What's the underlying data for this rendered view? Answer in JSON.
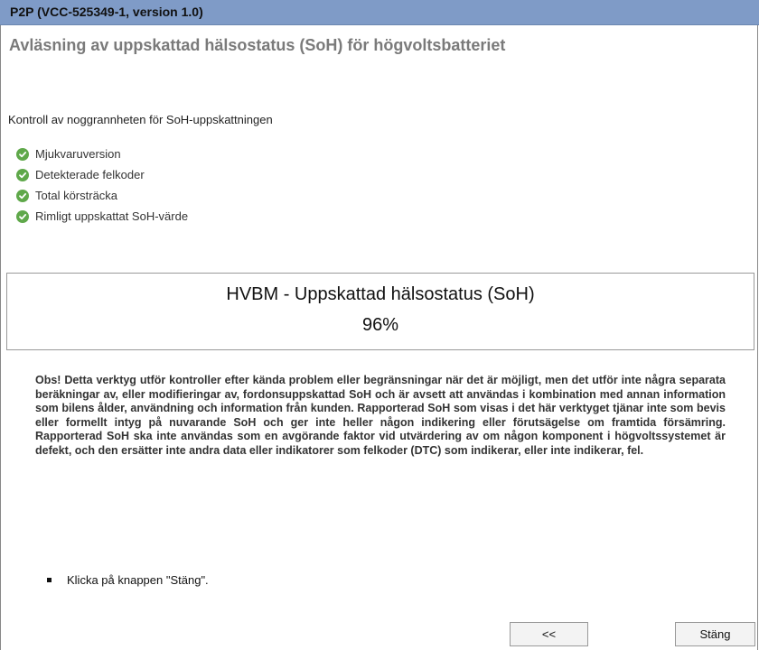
{
  "window": {
    "title": "P2P   (VCC-525349-1, version 1.0)"
  },
  "page": {
    "heading": "Avläsning av uppskattad hälsostatus (SoH) för högvoltsbatteriet",
    "subheading": "Kontroll av noggrannheten för SoH-uppskattningen",
    "checks": [
      {
        "label": "Mjukvaruversion",
        "icon": "check-circle-icon"
      },
      {
        "label": "Detekterade felkoder",
        "icon": "check-circle-icon"
      },
      {
        "label": "Total körsträcka",
        "icon": "check-circle-icon"
      },
      {
        "label": "Rimligt uppskattat SoH-värde",
        "icon": "check-circle-icon"
      }
    ],
    "result": {
      "title": "HVBM - Uppskattad hälsostatus (SoH)",
      "value": "96%"
    },
    "notice": "Obs!  Detta verktyg utför kontroller efter kända problem eller begränsningar när det är möjligt, men det utför inte några separata beräkningar av, eller modifieringar av, fordonsuppskattad SoH och är avsett att användas i kombination med annan information som bilens ålder, användning och information från kunden. Rapporterad SoH som visas i det här verktyget tjänar inte som bevis eller formellt intyg på nuvarande SoH och ger inte heller någon indikering eller förutsägelse om framtida försämring. Rapporterad SoH ska inte användas som en avgörande faktor vid utvärdering av om någon komponent i högvoltssystemet är defekt, och den ersätter inte andra data eller indikatorer som felkoder (DTC) som indikerar, eller inte indikerar, fel.",
    "instruction": "Klicka på knappen \"Stäng\"."
  },
  "buttons": {
    "back_label": "<<",
    "close_label": "Stäng"
  },
  "colors": {
    "titlebar": "#7f9bc7",
    "check": "#5fa84a",
    "heading": "#7a7a7a"
  }
}
